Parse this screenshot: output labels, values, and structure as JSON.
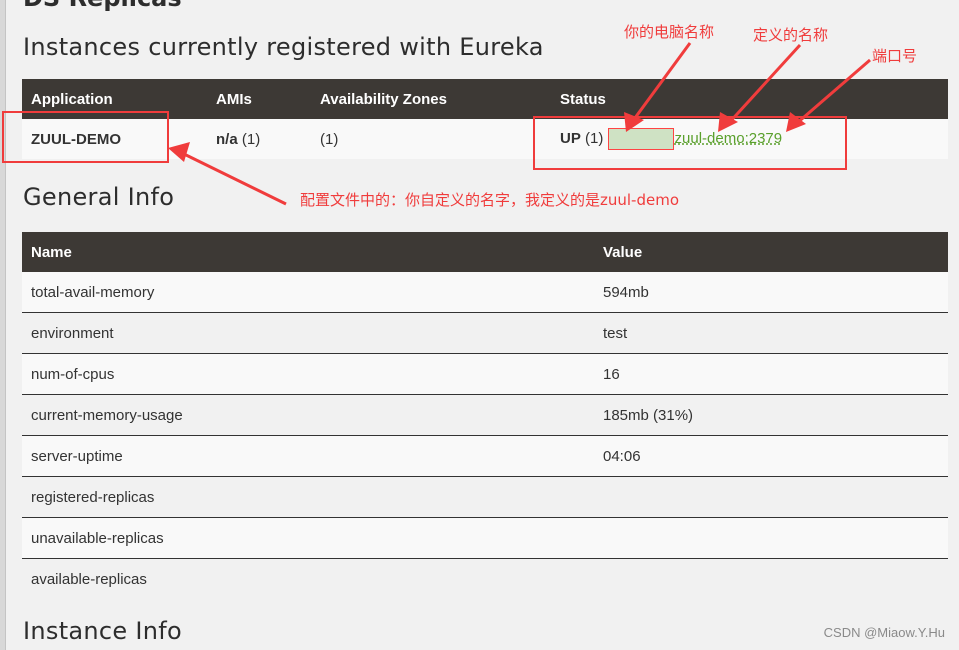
{
  "page": {
    "cut_off_heading": "DS Replicas",
    "instances_heading": "Instances currently registered with Eureka",
    "general_heading": "General Info",
    "instance_info_heading": "Instance Info"
  },
  "instances_table": {
    "headers": [
      "Application",
      "AMIs",
      "Availability Zones",
      "Status"
    ],
    "rows": [
      {
        "application": "ZUUL-DEMO",
        "amis_bold": "n/a",
        "amis_count": "(1)",
        "zones": "(1)",
        "status_bold": "UP",
        "status_count": "(1)",
        "status_link": "zuul-demo:2379"
      }
    ]
  },
  "general_table": {
    "headers": [
      "Name",
      "Value"
    ],
    "rows": [
      {
        "name": "total-avail-memory",
        "value": "594mb"
      },
      {
        "name": "environment",
        "value": "test"
      },
      {
        "name": "num-of-cpus",
        "value": "16"
      },
      {
        "name": "current-memory-usage",
        "value": "185mb (31%)"
      },
      {
        "name": "server-uptime",
        "value": "04:06"
      },
      {
        "name": "registered-replicas",
        "value": ""
      },
      {
        "name": "unavailable-replicas",
        "value": ""
      },
      {
        "name": "available-replicas",
        "value": ""
      }
    ]
  },
  "annotations": {
    "computer_name": "你的电脑名称",
    "defined_name": "定义的名称",
    "port": "端口号",
    "config_note": "配置文件中的：你自定义的名字，我定义的是zuul-demo",
    "color": "#f03c3c"
  },
  "watermark": "CSDN @Miaow.Y.Hu",
  "colors": {
    "header_bg": "#3d3935",
    "link_green": "#5aa02c",
    "page_bg": "#f1f1f1"
  }
}
